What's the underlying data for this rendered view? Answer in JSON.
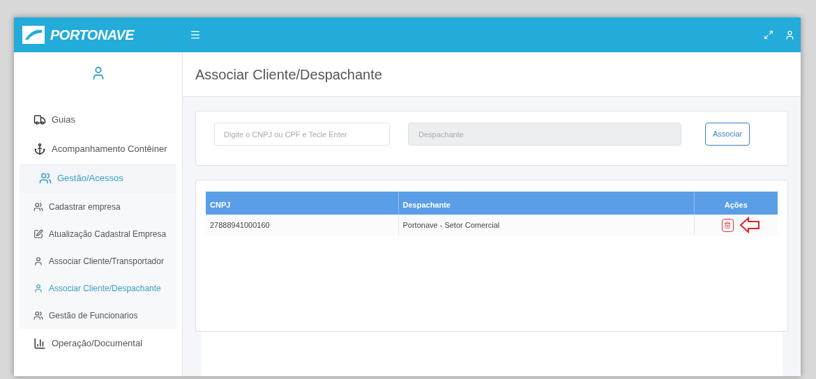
{
  "header": {
    "logo": "PORTONAVE"
  },
  "page_title": "Associar Cliente/Despachante",
  "sidebar": {
    "items": [
      {
        "kind": "top",
        "label": "Guias",
        "selected": false
      },
      {
        "kind": "top",
        "label": "Acompanhamento Contêiner",
        "selected": false
      },
      {
        "kind": "section",
        "label": "Gestão/Acessos",
        "selected": true
      },
      {
        "kind": "sub",
        "label": "Cadastrar empresa",
        "selected": false
      },
      {
        "kind": "sub",
        "label": "Atualização Cadastral Empresa",
        "selected": false
      },
      {
        "kind": "sub",
        "label": "Associar Cliente/Transportador",
        "selected": false
      },
      {
        "kind": "sub",
        "label": "Associar Cliente/Despachante",
        "selected": true
      },
      {
        "kind": "sub",
        "label": "Gestão de Funcionarios",
        "selected": false
      },
      {
        "kind": "top",
        "label": "Operação/Documental",
        "selected": false
      }
    ]
  },
  "form": {
    "cnpj_field": {
      "placeholder": "Digite o CNPJ ou CPF e Tecle Enter"
    },
    "despachante_field": {
      "placeholder": "Despachante",
      "disabled": true
    },
    "button": "Associar"
  },
  "table": {
    "columns": [
      "CNPJ",
      "Despachante",
      "Ações"
    ],
    "rows": [
      {
        "cnpj": "27888941000160",
        "despachante": "Portonave - Setor Comercial"
      }
    ]
  }
}
